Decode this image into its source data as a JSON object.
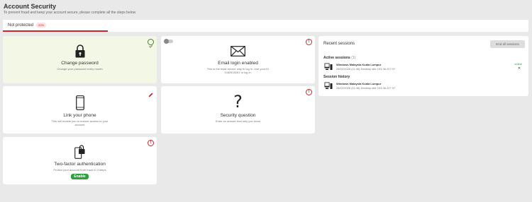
{
  "header": {
    "title": "Account Security",
    "subtitle": "To prevent fraud and keep your account secure, please complete all the steps below"
  },
  "status": {
    "label": "Not protected",
    "percent": "20%"
  },
  "cards": {
    "change_password": {
      "title": "Change password",
      "desc": "Change your password every month",
      "state": "done"
    },
    "email_login": {
      "title": "Email login enabled",
      "desc_line1": "This is the least secure way to log in. Use your ID",
      "desc_line2": "1482618261 to log in.",
      "state": "warning"
    },
    "link_phone": {
      "title": "Link your phone",
      "desc_line1": "This will enable you to restore access to your",
      "desc_line2": "account"
    },
    "security_question": {
      "title": "Security question",
      "desc": "Enter an answer that only you know"
    },
    "two_factor": {
      "title": "Two-factor authentication",
      "desc": "Protect your account from fraud in 2 steps",
      "button": "Enable"
    }
  },
  "sessions": {
    "title": "Recent sessions",
    "end_all": "End all sessions",
    "active_label": "Active sessions",
    "active_count": "(1)",
    "history_label": "Session history",
    "active": [
      {
        "name": "Windows Malaysia Kuala Lumpur",
        "meta": "28/02/2026 (11:35) Desktop site 193.36.227.97",
        "status": "online"
      }
    ],
    "history": [
      {
        "name": "Windows Malaysia Kuala Lumpur",
        "meta": "28/02/2026 (11:35) Desktop site 193.36.227.97"
      }
    ]
  },
  "colors": {
    "accent_red": "#c62828",
    "success_green": "#2e9e3e",
    "done_bg": "#f2f7e6"
  }
}
